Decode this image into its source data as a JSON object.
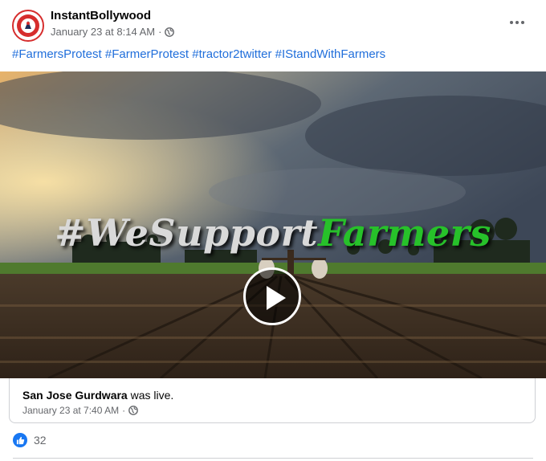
{
  "post": {
    "page_name": "InstantBollywood",
    "timestamp": "January 23 at 8:14 AM",
    "separator": "·",
    "privacy_icon": "globe-icon",
    "more_icon": "more-options-icon",
    "hashtags": [
      "#FarmersProtest",
      "#FarmerProtest",
      "#tractor2twitter",
      "#IStandWithFarmers"
    ],
    "video": {
      "overlay_word_1": "#WeSupport",
      "overlay_word_2": "Farmers",
      "play_icon": "play-icon"
    },
    "shared_live": {
      "name": "San Jose Gurdwara",
      "suffix": "was live.",
      "timestamp": "January 23 at 7:40 AM"
    },
    "reactions": {
      "icon": "like-icon",
      "count": "32"
    }
  },
  "colors": {
    "link": "#216fdb",
    "meta_text": "#65676b",
    "like_blue": "#1877f2",
    "overlay_green": "#27c12a"
  }
}
